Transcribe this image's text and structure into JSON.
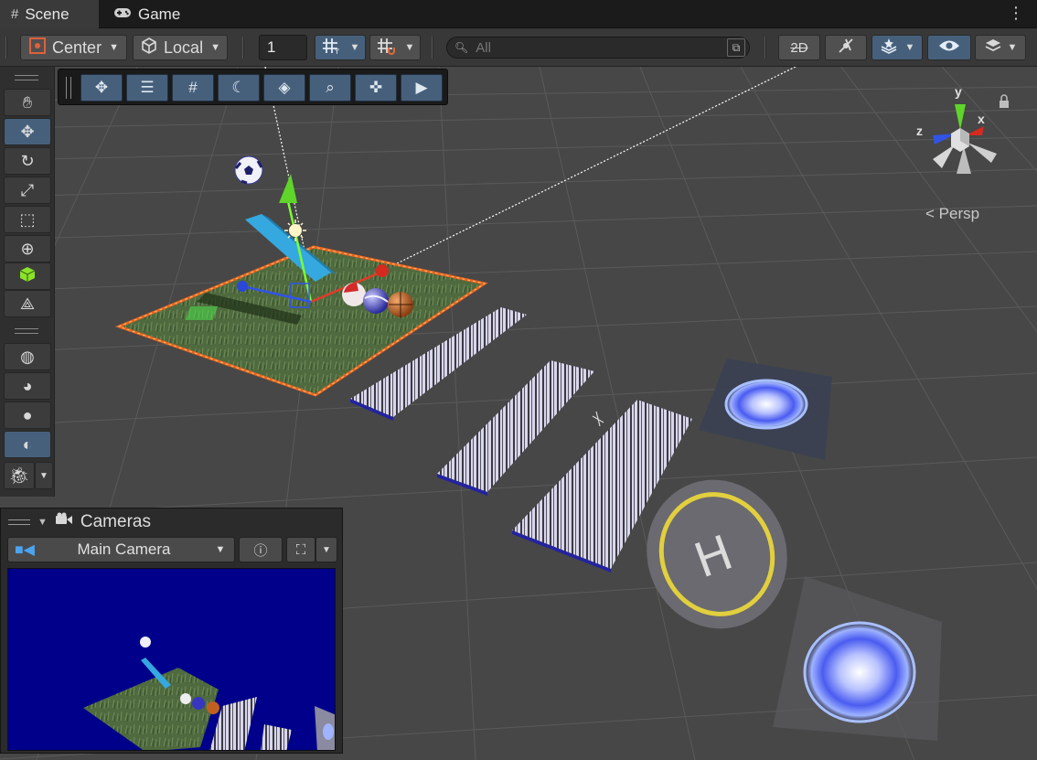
{
  "tabs": [
    {
      "label": "Scene",
      "icon": "hash-icon",
      "active": true
    },
    {
      "label": "Game",
      "icon": "gamepad-icon",
      "active": false
    }
  ],
  "toolbar": {
    "pivot_mode": "Center",
    "pivot_rotation": "Local",
    "grid_size_value": "1",
    "search_placeholder": "All"
  },
  "gizmo": {
    "x_label": "x",
    "y_label": "y",
    "z_label": "z",
    "projection_label": "Persp"
  },
  "cameras_overlay": {
    "title": "Cameras",
    "selected_camera": "Main Camera"
  },
  "colors": {
    "accent_blue": "#46607c",
    "selection_orange": "#e8641e",
    "camera_preview_bg": "#00008a",
    "grid_bg": "#474747"
  }
}
